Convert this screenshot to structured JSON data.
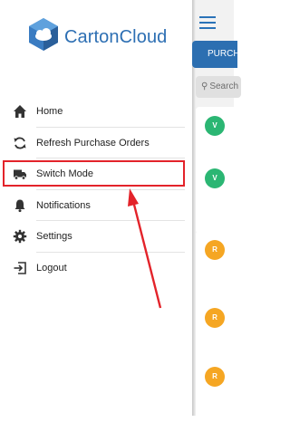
{
  "app": {
    "brand": "CartonCloud"
  },
  "drawer": {
    "items": [
      {
        "label": "Home",
        "icon": "home-icon"
      },
      {
        "label": "Refresh Purchase Orders",
        "icon": "refresh-icon"
      },
      {
        "label": "Switch Mode",
        "icon": "truck-icon"
      },
      {
        "label": "Notifications",
        "icon": "bell-icon"
      },
      {
        "label": "Settings",
        "icon": "gear-icon"
      },
      {
        "label": "Logout",
        "icon": "logout-icon"
      }
    ],
    "highlight_color": "#e3232a"
  },
  "main": {
    "tab_label": "PURCHASE",
    "search_placeholder": "Search",
    "cards": [
      {
        "badge": "V",
        "color": "#2bb673"
      },
      {
        "badge": "V",
        "color": "#2bb673"
      },
      {
        "badge": "R",
        "color": "#f5a623"
      },
      {
        "badge": "R",
        "color": "#f5a623"
      },
      {
        "badge": "R",
        "color": "#f5a623"
      }
    ],
    "accent_color": "#2c6fb1"
  }
}
